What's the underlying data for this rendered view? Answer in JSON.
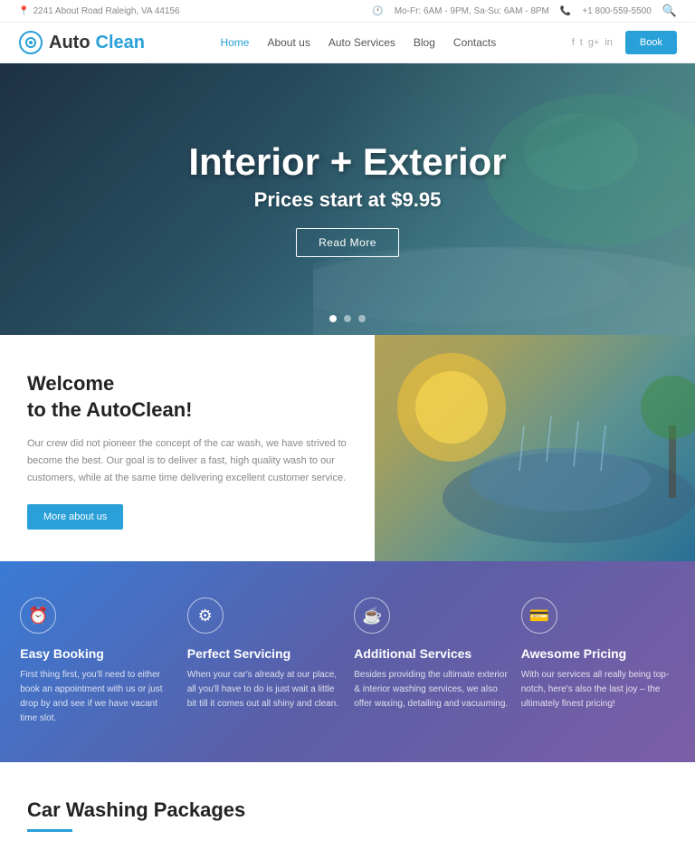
{
  "topbar": {
    "address": "2241 About Road Raleigh, VA 44156",
    "hours": "Mo-Fr: 6AM - 9PM, Sa-Su: 6AM - 8PM",
    "phone": "+1 800-559-5500"
  },
  "header": {
    "logo_auto": "Auto",
    "logo_clean": "Clean",
    "nav_items": [
      {
        "label": "Home",
        "active": true
      },
      {
        "label": "About us",
        "active": false
      },
      {
        "label": "Auto Services",
        "active": false
      },
      {
        "label": "Blog",
        "active": false
      },
      {
        "label": "Contacts",
        "active": false
      }
    ],
    "book_label": "Book"
  },
  "hero": {
    "title": "Interior + Exterior",
    "subtitle": "Prices start at $9.95",
    "cta_label": "Read More",
    "dots": [
      {
        "active": true
      },
      {
        "active": false
      },
      {
        "active": false
      }
    ]
  },
  "welcome": {
    "title_line1": "Welcome",
    "title_line2": "to the AutoClean!",
    "description": "Our crew did not pioneer the concept of the car wash, we have strived to become the best. Our goal is to deliver a fast, high quality wash to our customers, while at the same time delivering excellent customer service.",
    "btn_label": "More about us"
  },
  "features": [
    {
      "icon": "⏰",
      "icon_name": "clock-icon",
      "title": "Easy Booking",
      "desc": "First thing first, you'll need to either book an appointment with us or just drop by and see if we have vacant time slot."
    },
    {
      "icon": "⚙",
      "icon_name": "gear-icon",
      "title": "Perfect Servicing",
      "desc": "When your car's already at our place, all you'll have to do is just wait a little bit till it comes out all shiny and clean."
    },
    {
      "icon": "☕",
      "icon_name": "coffee-icon",
      "title": "Additional Services",
      "desc": "Besides providing the ultimate exterior & interior washing services, we also offer waxing, detailing and vacuuming."
    },
    {
      "icon": "💳",
      "icon_name": "wallet-icon",
      "title": "Awesome Pricing",
      "desc": "With our services all really being top-notch, here's also the last joy – the ultimately finest pricing!"
    }
  ],
  "packages": {
    "title": "Car Washing Packages"
  }
}
